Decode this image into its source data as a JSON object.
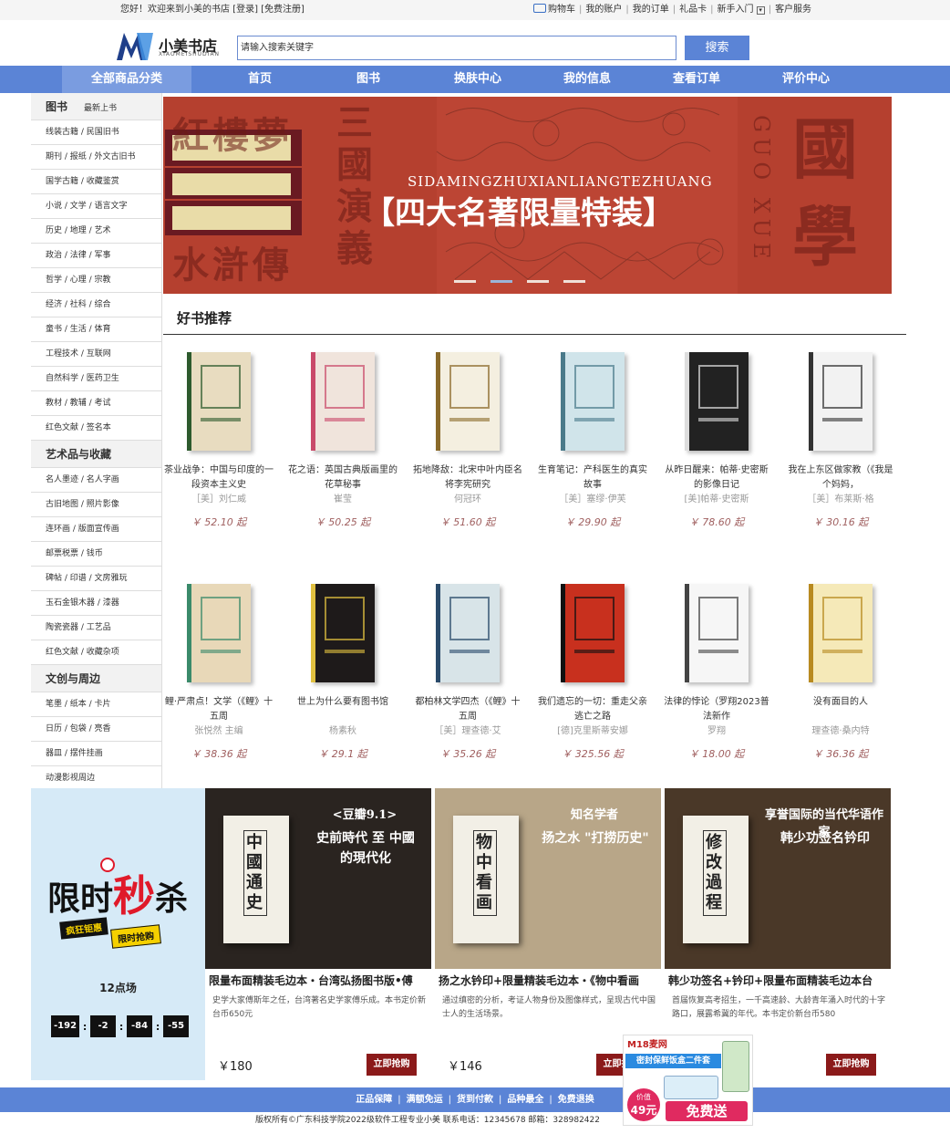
{
  "topbar": {
    "welcome": "您好！欢迎来到小美的书店 [登录] [免费注册]",
    "links": [
      "购物车",
      "我的账户",
      "我的订单",
      "礼品卡",
      "新手入门",
      "客户服务"
    ]
  },
  "header": {
    "logo_name": "小美书店",
    "logo_sub": "XIAOMEISHUDIAN",
    "search_placeholder": "请输入搜索关键字",
    "search_button": "搜索"
  },
  "nav": {
    "category": "全部商品分类",
    "items": [
      "首页",
      "图书",
      "换肤中心",
      "我的信息",
      "查看订单",
      "评价中心"
    ]
  },
  "sidebar": {
    "sections": [
      {
        "title": "图书",
        "extra": "最新上书",
        "items": [
          "线装古籍 / 民国旧书",
          "期刊 / 报纸 / 外文古旧书",
          "国学古籍 / 收藏鉴赏",
          "小说 / 文学 / 语言文字",
          "历史 / 地理 / 艺术",
          "政治 / 法律 / 军事",
          "哲学 / 心理 / 宗教",
          "经济 / 社科 / 综合",
          "童书 / 生活 / 体育",
          "工程技术 / 互联网",
          "自然科学 / 医药卫生",
          "教材 / 教辅 / 考试",
          "红色文献 / 签名本"
        ]
      },
      {
        "title": "艺术品与收藏",
        "extra": "",
        "items": [
          "名人墨迹 / 名人字画",
          "古旧地图 / 照片影像",
          "连环画 / 版面宣传画",
          "邮票税票 / 钱币",
          "碑帖 / 印谱 / 文房雅玩",
          "玉石金银木器 / 漆器",
          "陶瓷瓷器 / 工艺品",
          "红色文献 / 收藏杂项"
        ]
      },
      {
        "title": "文创与周边",
        "extra": "",
        "items": [
          "笔墨 / 纸本 / 卡片",
          "日历 / 包袋 / 亮香",
          "器皿 / 摆件挂画",
          "动漫影视周边"
        ]
      }
    ]
  },
  "banner": {
    "pinyin": "SIDAMINGZHUXIANLIANGTEZHUANG",
    "headline": "【四大名著限量特装】",
    "left_top": "紅樓夢",
    "left_mid": "三國演義",
    "left_bottom": "水滸傳",
    "right_vertical": "GUO XUE",
    "right_big": "國學",
    "slides": 4,
    "active_slide": 1
  },
  "recommend": {
    "title": "好书推荐",
    "books": [
      {
        "title": "茶业战争：中国与印度的一段资本主义史",
        "author": "［美］刘仁威",
        "price": "￥ 52.10 起",
        "color": "#e8dcc0",
        "accent": "#2d5a2d"
      },
      {
        "title": "花之语：英国古典版画里的花草秘事",
        "author": "崔莹",
        "price": "￥ 50.25 起",
        "color": "#f0e4dc",
        "accent": "#c94a6a"
      },
      {
        "title": "拓地降敌：北宋中叶内臣名将李宪研究",
        "author": "何冠环",
        "price": "￥ 51.60 起",
        "color": "#f4efe0",
        "accent": "#8a6a2a"
      },
      {
        "title": "生育笔记：产科医生的真实故事",
        "author": "［美］塞缪·伊芙",
        "price": "￥ 29.90 起",
        "color": "#d0e4ea",
        "accent": "#4a7a8a"
      },
      {
        "title": "从昨日醒来：帕蒂·史密斯的影像日记",
        "author": "[美]帕蒂·史密斯",
        "price": "￥ 78.60 起",
        "color": "#222222",
        "accent": "#dddddd"
      },
      {
        "title": "我在上东区做家教（《我是个妈妈，",
        "author": "［美］布莱斯·格",
        "price": "￥ 30.16 起",
        "color": "#f2f2f2",
        "accent": "#333333"
      },
      {
        "title": "鲤·严肃点！文学（《鲤》十五周",
        "author": "张悦然 主编",
        "price": "￥ 38.36 起",
        "color": "#e8d8b8",
        "accent": "#3a8a6a"
      },
      {
        "title": "世上为什么要有图书馆",
        "author": "杨素秋",
        "price": "￥ 29.1 起",
        "color": "#1e1a1a",
        "accent": "#e0c040"
      },
      {
        "title": "都柏林文学四杰（《鲤》十五周",
        "author": "［美］理查德·艾",
        "price": "￥ 35.26 起",
        "color": "#d8e4e8",
        "accent": "#2a4a6a"
      },
      {
        "title": "我们遗忘的一切：重走父亲逃亡之路",
        "author": "[德]克里斯蒂安娜",
        "price": "￥ 325.56 起",
        "color": "#c8301e",
        "accent": "#111111"
      },
      {
        "title": "法律的悖论（罗翔2023普法新作",
        "author": "罗翔",
        "price": "￥ 18.00 起",
        "color": "#f6f6f6",
        "accent": "#444444"
      },
      {
        "title": "没有面目的人",
        "author": "理查德·桑内特",
        "price": "￥ 36.36 起",
        "color": "#f5e9b8",
        "accent": "#b88a20"
      }
    ]
  },
  "flash_sale": {
    "title_a": "限时",
    "title_b": "秒",
    "title_c": "杀",
    "tag1": "疯狂钜惠",
    "tag2": "限时抢购",
    "session": "12点场",
    "timer": [
      "-192",
      "-2",
      "-84",
      "-55"
    ]
  },
  "deals": [
    {
      "title": "限量布面精装毛边本・台湾弘扬图书版•傅",
      "desc": "史学大家傅斯年之任，台湾著名史学家傅乐成。本书定价新台币650元",
      "price": "￥180",
      "buy": "立即抢购",
      "img_text": "中國通史",
      "img_tag": "<豆瓣9.1>",
      "img_line": "史前時代 至 中國的現代化",
      "bg": "#2a2420"
    },
    {
      "title": "扬之水钤印+限量精装毛边本・《物中看画",
      "desc": "通过缜密的分析，考证人物身份及图像样式，呈现古代中国士人的生活场景。",
      "price": "￥146",
      "buy": "立即抢购",
      "img_text": "物中看画",
      "img_tag": "知名学者",
      "img_line": "扬之水 \"打捞历史\"",
      "bg": "#b8a688"
    },
    {
      "title": "韩少功签名+钤印+限量布面精装毛边本台",
      "desc": "首届恢复高考招生，一千高速龄、大龄青年涌入时代的十字路口，展露希冀的年代。本书定价新台币580",
      "price": "￥",
      "buy": "立即抢购",
      "img_text": "修改過程",
      "img_tag": "享誉国际的当代华语作家",
      "img_line": "韩少功签名钤印",
      "bg": "#4a3828"
    }
  ],
  "footer": {
    "links": [
      "正品保障",
      "满额免运",
      "货到付款",
      "品种最全",
      "免费退换"
    ],
    "copyright": "版权所有©广东科技学院2022级软件工程专业小美   联系电话：12345678   邮箱：328982422"
  },
  "ad": {
    "brand": "M18麦网",
    "line1": "密封保鲜饭盒二件套",
    "price_label": "价值",
    "price": "49元",
    "cta": "免费送"
  }
}
